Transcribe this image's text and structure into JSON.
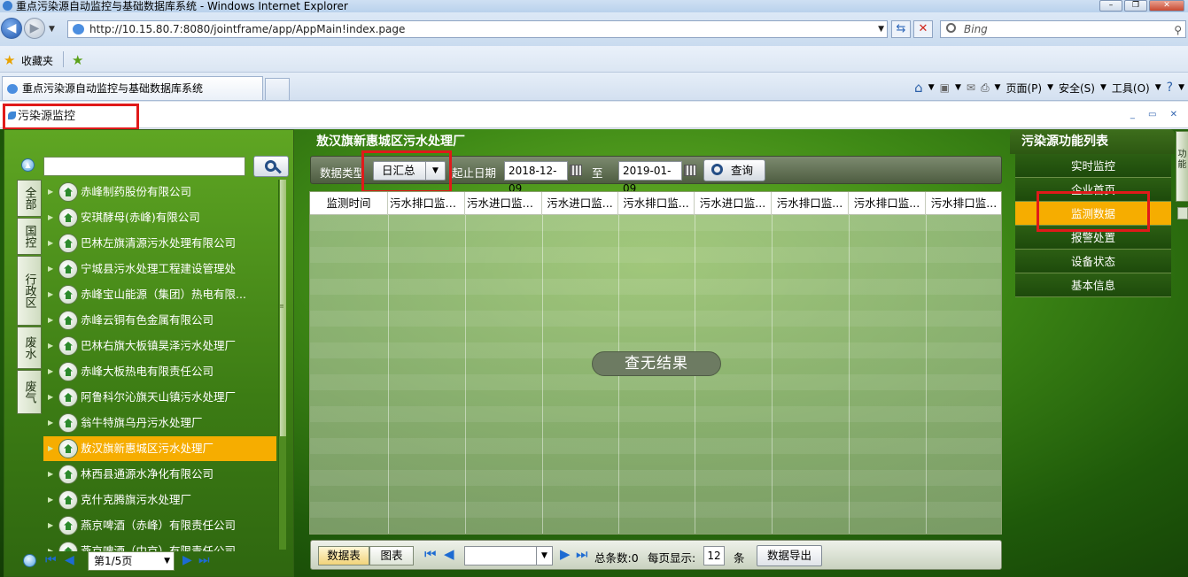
{
  "browser": {
    "window_title": "重点污染源自动监控与基础数据库系统 - Windows Internet Explorer",
    "url": "http://10.15.80.7:8080/jointframe/app/AppMain!index.page",
    "search_placeholder": "Bing",
    "favorites_label": "收藏夹",
    "tab_title": "重点污染源自动监控与基础数据库系统",
    "menu_page": "页面(P)",
    "menu_safety": "安全(S)",
    "menu_tools": "工具(O)"
  },
  "app": {
    "module_title": "污染源监控"
  },
  "left": {
    "vertical_tabs": [
      "全部",
      "国控",
      "行政区",
      "废水",
      "废气"
    ],
    "tree_items": [
      "赤峰制药股份有限公司",
      "安琪酵母(赤峰)有限公司",
      "巴林左旗清源污水处理有限公司",
      "宁城县污水处理工程建设管理处",
      "赤峰宝山能源（集团）热电有限...",
      "赤峰云铜有色金属有限公司",
      "巴林右旗大板镇昊泽污水处理厂",
      "赤峰大板热电有限责任公司",
      "阿鲁科尔沁旗天山镇污水处理厂",
      "翁牛特旗乌丹污水处理厂",
      "敖汉旗新惠城区污水处理厂",
      "林西县通源水净化有限公司",
      "克什克腾旗污水处理厂",
      "燕京啤酒（赤峰）有限责任公司",
      "燕京啤酒（中京）有限责任公司"
    ],
    "selected_index": 10,
    "page_select": "第1/5页"
  },
  "center": {
    "title": "敖汉旗新惠城区污水处理厂",
    "data_type_label": "数据类型",
    "data_type_value": "日汇总",
    "date_range_label": "起止日期",
    "date_from": "2018-12-09",
    "to_label": "至",
    "date_to": "2019-01-09",
    "query_button": "查询",
    "columns": [
      "监测时间",
      "污水排口监控...",
      "污水进口监控...",
      "污水进口监...",
      "污水排口监...",
      "污水进口监...",
      "污水排口监...",
      "污水排口监...",
      "污水排口监..."
    ],
    "empty_message": "查无结果",
    "tab_table": "数据表",
    "tab_chart": "图表",
    "total_label": "总条数:0",
    "per_page_label": "每页显示:",
    "per_page_value": "12",
    "unit_label": "条",
    "export_button": "数据导出"
  },
  "right": {
    "title": "污染源功能列表",
    "menu": [
      "实时监控",
      "企业首页",
      "监测数据",
      "报警处置",
      "设备状态",
      "基本信息"
    ],
    "active_index": 2,
    "edge_tab": "功能"
  },
  "colors": {
    "highlight": "#f6ad00",
    "annotation_red": "#e01a1a"
  }
}
